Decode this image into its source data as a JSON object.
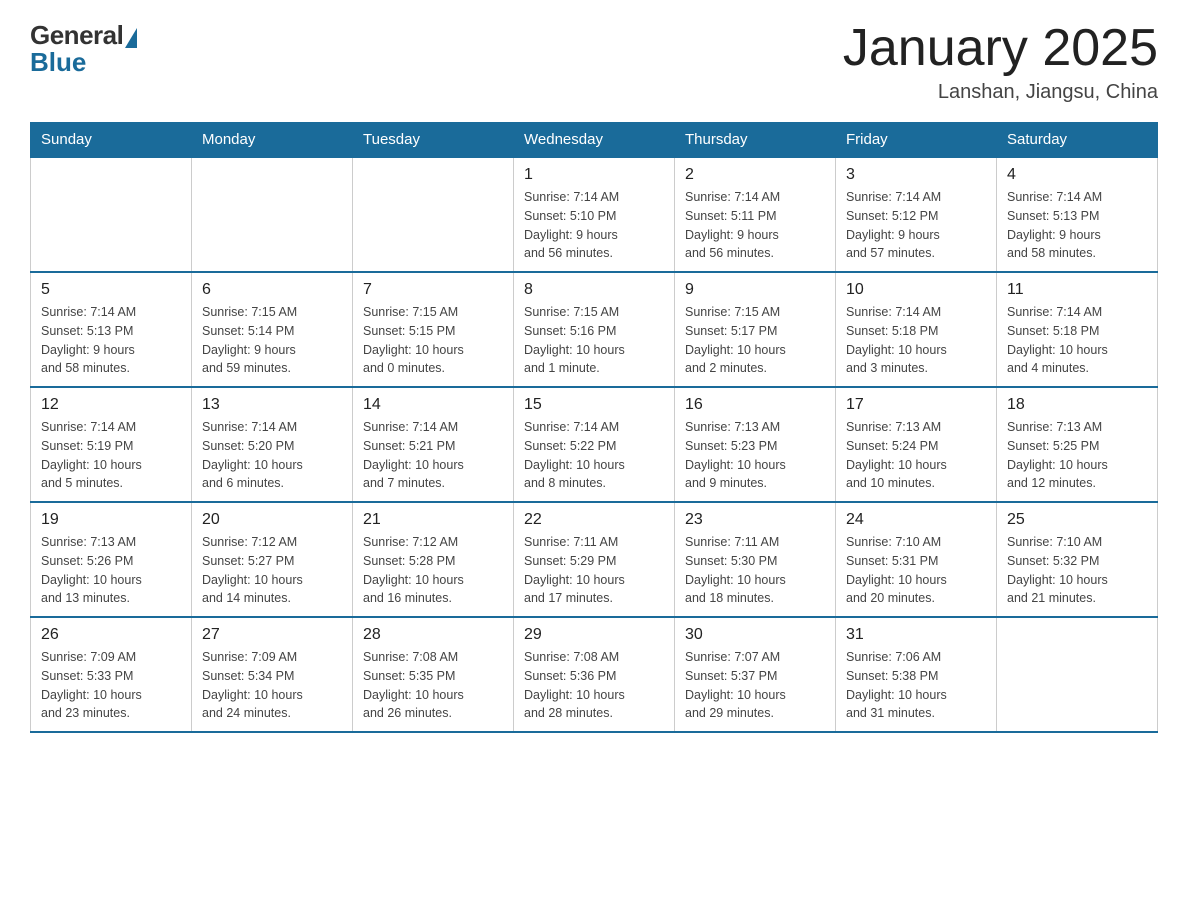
{
  "header": {
    "logo_general": "General",
    "logo_blue": "Blue",
    "month_title": "January 2025",
    "location": "Lanshan, Jiangsu, China"
  },
  "weekdays": [
    "Sunday",
    "Monday",
    "Tuesday",
    "Wednesday",
    "Thursday",
    "Friday",
    "Saturday"
  ],
  "weeks": [
    [
      {
        "day": "",
        "info": ""
      },
      {
        "day": "",
        "info": ""
      },
      {
        "day": "",
        "info": ""
      },
      {
        "day": "1",
        "info": "Sunrise: 7:14 AM\nSunset: 5:10 PM\nDaylight: 9 hours\nand 56 minutes."
      },
      {
        "day": "2",
        "info": "Sunrise: 7:14 AM\nSunset: 5:11 PM\nDaylight: 9 hours\nand 56 minutes."
      },
      {
        "day": "3",
        "info": "Sunrise: 7:14 AM\nSunset: 5:12 PM\nDaylight: 9 hours\nand 57 minutes."
      },
      {
        "day": "4",
        "info": "Sunrise: 7:14 AM\nSunset: 5:13 PM\nDaylight: 9 hours\nand 58 minutes."
      }
    ],
    [
      {
        "day": "5",
        "info": "Sunrise: 7:14 AM\nSunset: 5:13 PM\nDaylight: 9 hours\nand 58 minutes."
      },
      {
        "day": "6",
        "info": "Sunrise: 7:15 AM\nSunset: 5:14 PM\nDaylight: 9 hours\nand 59 minutes."
      },
      {
        "day": "7",
        "info": "Sunrise: 7:15 AM\nSunset: 5:15 PM\nDaylight: 10 hours\nand 0 minutes."
      },
      {
        "day": "8",
        "info": "Sunrise: 7:15 AM\nSunset: 5:16 PM\nDaylight: 10 hours\nand 1 minute."
      },
      {
        "day": "9",
        "info": "Sunrise: 7:15 AM\nSunset: 5:17 PM\nDaylight: 10 hours\nand 2 minutes."
      },
      {
        "day": "10",
        "info": "Sunrise: 7:14 AM\nSunset: 5:18 PM\nDaylight: 10 hours\nand 3 minutes."
      },
      {
        "day": "11",
        "info": "Sunrise: 7:14 AM\nSunset: 5:18 PM\nDaylight: 10 hours\nand 4 minutes."
      }
    ],
    [
      {
        "day": "12",
        "info": "Sunrise: 7:14 AM\nSunset: 5:19 PM\nDaylight: 10 hours\nand 5 minutes."
      },
      {
        "day": "13",
        "info": "Sunrise: 7:14 AM\nSunset: 5:20 PM\nDaylight: 10 hours\nand 6 minutes."
      },
      {
        "day": "14",
        "info": "Sunrise: 7:14 AM\nSunset: 5:21 PM\nDaylight: 10 hours\nand 7 minutes."
      },
      {
        "day": "15",
        "info": "Sunrise: 7:14 AM\nSunset: 5:22 PM\nDaylight: 10 hours\nand 8 minutes."
      },
      {
        "day": "16",
        "info": "Sunrise: 7:13 AM\nSunset: 5:23 PM\nDaylight: 10 hours\nand 9 minutes."
      },
      {
        "day": "17",
        "info": "Sunrise: 7:13 AM\nSunset: 5:24 PM\nDaylight: 10 hours\nand 10 minutes."
      },
      {
        "day": "18",
        "info": "Sunrise: 7:13 AM\nSunset: 5:25 PM\nDaylight: 10 hours\nand 12 minutes."
      }
    ],
    [
      {
        "day": "19",
        "info": "Sunrise: 7:13 AM\nSunset: 5:26 PM\nDaylight: 10 hours\nand 13 minutes."
      },
      {
        "day": "20",
        "info": "Sunrise: 7:12 AM\nSunset: 5:27 PM\nDaylight: 10 hours\nand 14 minutes."
      },
      {
        "day": "21",
        "info": "Sunrise: 7:12 AM\nSunset: 5:28 PM\nDaylight: 10 hours\nand 16 minutes."
      },
      {
        "day": "22",
        "info": "Sunrise: 7:11 AM\nSunset: 5:29 PM\nDaylight: 10 hours\nand 17 minutes."
      },
      {
        "day": "23",
        "info": "Sunrise: 7:11 AM\nSunset: 5:30 PM\nDaylight: 10 hours\nand 18 minutes."
      },
      {
        "day": "24",
        "info": "Sunrise: 7:10 AM\nSunset: 5:31 PM\nDaylight: 10 hours\nand 20 minutes."
      },
      {
        "day": "25",
        "info": "Sunrise: 7:10 AM\nSunset: 5:32 PM\nDaylight: 10 hours\nand 21 minutes."
      }
    ],
    [
      {
        "day": "26",
        "info": "Sunrise: 7:09 AM\nSunset: 5:33 PM\nDaylight: 10 hours\nand 23 minutes."
      },
      {
        "day": "27",
        "info": "Sunrise: 7:09 AM\nSunset: 5:34 PM\nDaylight: 10 hours\nand 24 minutes."
      },
      {
        "day": "28",
        "info": "Sunrise: 7:08 AM\nSunset: 5:35 PM\nDaylight: 10 hours\nand 26 minutes."
      },
      {
        "day": "29",
        "info": "Sunrise: 7:08 AM\nSunset: 5:36 PM\nDaylight: 10 hours\nand 28 minutes."
      },
      {
        "day": "30",
        "info": "Sunrise: 7:07 AM\nSunset: 5:37 PM\nDaylight: 10 hours\nand 29 minutes."
      },
      {
        "day": "31",
        "info": "Sunrise: 7:06 AM\nSunset: 5:38 PM\nDaylight: 10 hours\nand 31 minutes."
      },
      {
        "day": "",
        "info": ""
      }
    ]
  ]
}
